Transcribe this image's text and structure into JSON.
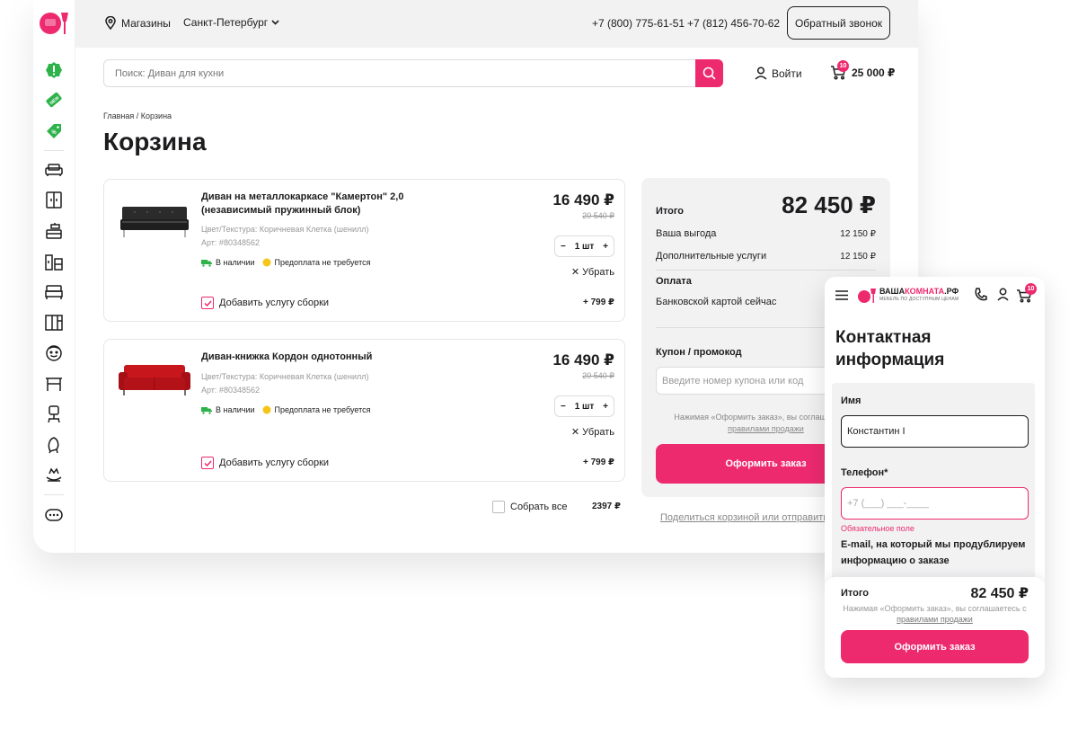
{
  "header": {
    "stores_label": "Магазины",
    "city": "Санкт-Петербург",
    "phone1": "+7 (800) 775-61-51",
    "phone2": "+7 (812) 456-70-62",
    "callback_label": "Обратный звонок"
  },
  "search": {
    "placeholder": "Поиск: Диван для кухни"
  },
  "account": {
    "login_label": "Войти"
  },
  "cart": {
    "count": "10",
    "total": "25 000 ₽"
  },
  "breadcrumb": "Главная / Корзина",
  "page_title": "Корзина",
  "sidebar": {
    "icons": [
      "alert-icon",
      "new-badge-icon",
      "discount-tag-icon",
      "sofa-icon",
      "wardrobe-icon",
      "kitchen-icon",
      "shelving-icon",
      "bed-icon",
      "cabinet-icon",
      "kids-icon",
      "table-icon",
      "office-chair-icon",
      "armchair-icon",
      "decor-icon",
      "more-icon"
    ]
  },
  "items": [
    {
      "name": "Диван на металлокаркасе \"Камертон\" 2,0 (независимый пружинный блок)",
      "price": "16 490 ₽",
      "old_price": "20 540 ₽",
      "color": "Цвет/Текстура: Коричневая Клетка (шенилл)",
      "article": "Арт: #80348562",
      "stock": "В наличии",
      "prepay": "Предоплата не требуется",
      "qty": "1 шт",
      "remove": "✕ Убрать",
      "assembly": "Добавить услугу сборки",
      "assembly_price": "+ 799 ₽",
      "color_hex": "#2b2b2b"
    },
    {
      "name": "Диван-книжка Кордон однотонный",
      "price": "16 490 ₽",
      "old_price": "20 540 ₽",
      "color": "Цвет/Текстура: Коричневая Клетка (шенилл)",
      "article": "Арт: #80348562",
      "stock": "В наличии",
      "prepay": "Предоплата не требуется",
      "qty": "1 шт",
      "remove": "✕ Убрать",
      "assembly": "Добавить услугу сборки",
      "assembly_price": "+ 799 ₽",
      "color_hex": "#c8161d"
    }
  ],
  "collect_all": {
    "label": "Собрать все",
    "sum": "2397 ₽"
  },
  "summary": {
    "total_label": "Итого",
    "total": "82 450 ₽",
    "savings_label": "Ваша выгода",
    "savings": "12 150 ₽",
    "services_label": "Дополнительные услуги",
    "services": "12 150 ₽",
    "payment_title": "Оплата",
    "payment_method": "Банковской картой сейчас",
    "coupon_title": "Купон / промокод",
    "coupon_placeholder": "Введите номер купона или код",
    "terms_text": "Нажимая «Оформить заказ», вы соглашаетесь с",
    "terms_link": "правилами продажи",
    "order_button": "Оформить заказ",
    "share_link": "Поделиться корзиной или отправить"
  },
  "mobile": {
    "logo_prefix": "ВАША",
    "logo_accent": "КОМНАТА",
    "logo_suffix": ".РФ",
    "logo_tagline": "МЕБЕЛЬ ПО ДОСТУПНЫМ ЦЕНАМ",
    "cart_count": "10",
    "title": "Контактная информация",
    "name_label": "Имя",
    "name_value": "Константин I",
    "phone_label": "Телефон*",
    "phone_placeholder": "+7 (___) ___-____",
    "required_error": "Обязательное поле",
    "email_label": "E-mail, на который мы продублируем информацию о заказе",
    "total_label": "Итого",
    "total": "82 450 ₽",
    "terms_text": "Нажимая «Оформить заказ», вы соглашаетесь с",
    "terms_link": "правилами продажи",
    "order_button": "Оформить заказ"
  },
  "colors": {
    "accent": "#ee2a6f",
    "stock_green": "#2eb24a",
    "coin_yellow": "#f5c518"
  }
}
